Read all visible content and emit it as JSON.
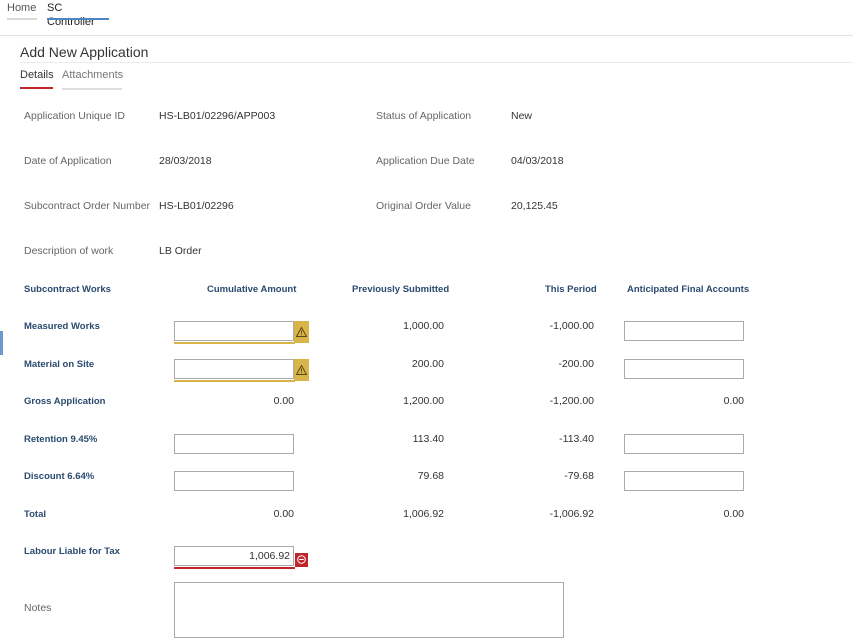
{
  "nav": {
    "home": "Home",
    "sc_controller": "SC Controller"
  },
  "page": {
    "title": "Add New Application",
    "tabs": {
      "details": "Details",
      "attachments": "Attachments"
    }
  },
  "fields": {
    "app_id_label": "Application Unique ID",
    "app_id_value": "HS-LB01/02296/APP003",
    "status_label": "Status of Application",
    "status_value": "New",
    "date_label": "Date of Application",
    "date_value": "28/03/2018",
    "due_label": "Application Due Date",
    "due_value": "04/03/2018",
    "order_num_label": "Subcontract Order Number",
    "order_num_value": "HS-LB01/02296",
    "order_value_label": "Original Order Value",
    "order_value_value": "20,125.45",
    "desc_label": "Description of work",
    "desc_value": "LB Order"
  },
  "table": {
    "headers": {
      "works": "Subcontract Works",
      "cumulative": "Cumulative Amount",
      "previous": "Previously Submitted",
      "period": "This Period",
      "anticipated": "Anticipated Final Accounts"
    },
    "measured": {
      "label": "Measured Works",
      "cumulative": "",
      "previous": "1,000.00",
      "period": "-1,000.00",
      "anticipated": ""
    },
    "material": {
      "label": "Material on Site",
      "cumulative": "",
      "previous": "200.00",
      "period": "-200.00",
      "anticipated": ""
    },
    "gross": {
      "label": "Gross Application",
      "cumulative": "0.00",
      "previous": "1,200.00",
      "period": "-1,200.00",
      "anticipated": "0.00"
    },
    "retention": {
      "label": "Retention 9.45%",
      "cumulative": "",
      "previous": "113.40",
      "period": "-113.40",
      "anticipated": ""
    },
    "discount": {
      "label": "Discount 6.64%",
      "cumulative": "",
      "previous": "79.68",
      "period": "-79.68",
      "anticipated": ""
    },
    "total": {
      "label": "Total",
      "cumulative": "0.00",
      "previous": "1,006.92",
      "period": "-1,006.92",
      "anticipated": "0.00"
    },
    "labour": {
      "label": "Labour Liable for Tax",
      "value": "1,006.92"
    }
  },
  "notes": {
    "label": "Notes",
    "value": ""
  },
  "icons": {
    "warning": "warning-icon",
    "error": "error-icon"
  },
  "colors": {
    "accent_blue": "#4a86c5",
    "error_red": "#c0272d",
    "warning_yellow": "#d8b54a",
    "header_navy": "#2a4a70"
  }
}
